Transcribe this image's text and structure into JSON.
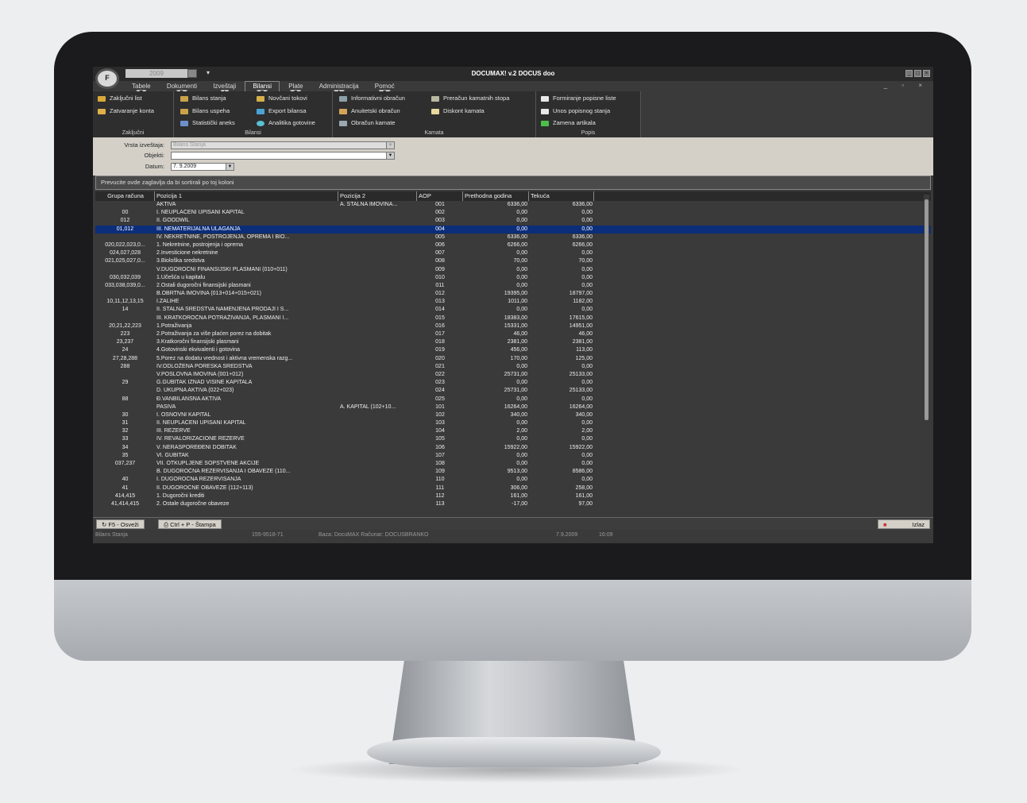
{
  "app": {
    "year": "2009",
    "title": "DOCUMAX! v.2 DOCUS doo",
    "logo_text": "F"
  },
  "menu": [
    {
      "label": "Tabele",
      "key": "T"
    },
    {
      "label": "Dokumenti",
      "key": "D"
    },
    {
      "label": "Izveštaji",
      "key": "I"
    },
    {
      "label": "Bilansi",
      "key": "B"
    },
    {
      "label": "Plate",
      "key": "P"
    },
    {
      "label": "Administracija",
      "key": "A"
    },
    {
      "label": "Pomoć",
      "key": "O"
    }
  ],
  "ribbon": {
    "zakljucni": {
      "label": "Zaključni",
      "items": [
        "Zaključni list",
        "Zatvaranje konta"
      ]
    },
    "bilansi": {
      "label": "Bilansi",
      "items": [
        "Bilans stanja",
        "Bilans uspeha",
        "Statistički aneks",
        "Novčani tokovi",
        "Export bilansa",
        "Analitika gotovine"
      ]
    },
    "kamata": {
      "label": "Kamata",
      "items": [
        "Informativni obračun",
        "Anuitetski obračun",
        "Obračun kamate",
        "Preračun kamatnih stopa",
        "Diskont kamata"
      ]
    },
    "popis": {
      "label": "Popis",
      "items": [
        "Formiranje popisne liste",
        "Unos popisnog stanja",
        "Zamena artikala"
      ]
    }
  },
  "filter": {
    "vrsta_label": "Vrsta izveštaja:",
    "vrsta_value": "Bilans Stanja",
    "objekti_label": "Objekti:",
    "objekti_value": "",
    "datum_label": "Datum:",
    "datum_value": "7. 9.2009"
  },
  "grid": {
    "group_hint": "Prevucite ovde zaglavlja da bi sortirali po toj koloni",
    "columns": [
      "Grupa računa",
      "Pozicija 1",
      "Pozicija 2",
      "AOP",
      "Prethodna godina",
      "Tekuća"
    ],
    "rows": [
      [
        "",
        "AKTIVA",
        "A. STALNA IMOVINA...",
        "001",
        "6336,00",
        "6336,00"
      ],
      [
        "00",
        "I. NEUPLAĆENI UPISANI KAPITAL",
        "",
        "002",
        "0,00",
        "0,00"
      ],
      [
        "012",
        "II. GOODWIL",
        "",
        "003",
        "0,00",
        "0,00"
      ],
      [
        "01,012",
        "III. NEMATERIJALNA ULAGANJA",
        "",
        "004",
        "0,00",
        "0,00"
      ],
      [
        "",
        "IV. NEKRETNINE, POSTROJENJA, OPREMA I BIO...",
        "",
        "005",
        "6336,00",
        "6336,00"
      ],
      [
        "020,022,023,0...",
        "1. Nekretnine, postrojenja i oprema",
        "",
        "006",
        "6266,00",
        "6266,00"
      ],
      [
        "024,027,028",
        "2.Investicione nekretnine",
        "",
        "007",
        "0,00",
        "0,00"
      ],
      [
        "021,025,027,0...",
        "3.Biološka sredstva",
        "",
        "008",
        "70,00",
        "70,00"
      ],
      [
        "",
        "V.DUGOROČNI FINANSIJSKI PLASMANI (010+011)",
        "",
        "009",
        "0,00",
        "0,00"
      ],
      [
        "030,032,039",
        "1.Učešća u kapitalu",
        "",
        "010",
        "0,00",
        "0,00"
      ],
      [
        "033,038,039,0...",
        "2.Ostali dugoročni finansijski plasmani",
        "",
        "011",
        "0,00",
        "0,00"
      ],
      [
        "",
        "B.OBRTNA IMOVINA (013+014+015+021)",
        "",
        "012",
        "19395,00",
        "18797,00"
      ],
      [
        "10,11,12,13,15",
        "I.ZALIHE",
        "",
        "013",
        "1011,00",
        "1182,00"
      ],
      [
        "14",
        "II. STALNA SREDSTVA NAMENJENA PRODAJI I S...",
        "",
        "014",
        "0,00",
        "0,00"
      ],
      [
        "",
        "III. KRATKOROČNA POTRAŽIVANJA, PLASMANI I...",
        "",
        "015",
        "18383,00",
        "17615,00"
      ],
      [
        "20,21,22,223",
        "1.Potraživanja",
        "",
        "016",
        "15331,00",
        "14951,00"
      ],
      [
        "223",
        "2.Potraživanja za više plaćen porez na dobitak",
        "",
        "017",
        "46,00",
        "46,00"
      ],
      [
        "23,237",
        "3.Kratkoročni finansijski plasmani",
        "",
        "018",
        "2381,00",
        "2381,00"
      ],
      [
        "24",
        "4.Gotovinski ekvivalenti i gotovina",
        "",
        "019",
        "456,00",
        "113,00"
      ],
      [
        "27,28,288",
        "5.Porez na dodatu vrednost i aktivna vremenska razg...",
        "",
        "020",
        "170,00",
        "125,00"
      ],
      [
        "288",
        "IV.ODLOŽENA PORESKA SREDSTVA",
        "",
        "021",
        "0,00",
        "0,00"
      ],
      [
        "",
        "V.POSLOVNA IMOVINA (001+012)",
        "",
        "022",
        "25731,00",
        "25133,00"
      ],
      [
        "29",
        "G.GUBITAK IZNAD VISINE KAPITALA",
        "",
        "023",
        "0,00",
        "0,00"
      ],
      [
        "",
        "D. UKUPNA AKTIVA (022+023)",
        "",
        "024",
        "25731,00",
        "25133,00"
      ],
      [
        "88",
        "Đ.VANBILANSNA AKTIVA",
        "",
        "025",
        "0,00",
        "0,00"
      ],
      [
        "",
        "PASIVA",
        "A. KAPITAL (102+10...",
        "101",
        "16264,00",
        "16264,00"
      ],
      [
        "30",
        "I. OSNOVNI KAPITAL",
        "",
        "102",
        "340,00",
        "340,00"
      ],
      [
        "31",
        "II. NEUPLAĆENI UPISANI KAPITAL",
        "",
        "103",
        "0,00",
        "0,00"
      ],
      [
        "32",
        "III. REZERVE",
        "",
        "104",
        "2,00",
        "2,00"
      ],
      [
        "33",
        "IV. REVALORIZACIONE REZERVE",
        "",
        "105",
        "0,00",
        "0,00"
      ],
      [
        "34",
        "V. NERASPOREĐENI DOBITAK",
        "",
        "106",
        "15922,00",
        "15922,00"
      ],
      [
        "35",
        "VI. GUBITAK",
        "",
        "107",
        "0,00",
        "0,00"
      ],
      [
        "037,237",
        "VII. OTKUPLJENE SOPSTVENE AKCIJE",
        "",
        "108",
        "0,00",
        "0,00"
      ],
      [
        "",
        "B. DUGOROČNA REZERVISANJA I OBAVEZE (110...",
        "",
        "109",
        "9513,00",
        "8586,00"
      ],
      [
        "40",
        "I. DUGOROČNA REZERVISANJA",
        "",
        "110",
        "0,00",
        "0,00"
      ],
      [
        "41",
        "II. DUGOROČNE OBAVEZE (112+113)",
        "",
        "111",
        "306,00",
        "258,00"
      ],
      [
        "414,415",
        "1. Dugoročni krediti",
        "",
        "112",
        "161,00",
        "161,00"
      ],
      [
        "41,414,415",
        "2. Ostale dugoročne obaveze",
        "",
        "113",
        "-17,00",
        "97,00"
      ]
    ]
  },
  "footer": {
    "refresh": "F5 - Osveži",
    "print": "Ctrl + P - Štampa",
    "exit": "Izlaz"
  },
  "status": {
    "report": "Bilans Stanja",
    "code": "155-9518-71",
    "db": "Baza: DocuMAX   Računar: DOCUSBRANKO",
    "date": "7.9.2009",
    "time": "16:09"
  }
}
